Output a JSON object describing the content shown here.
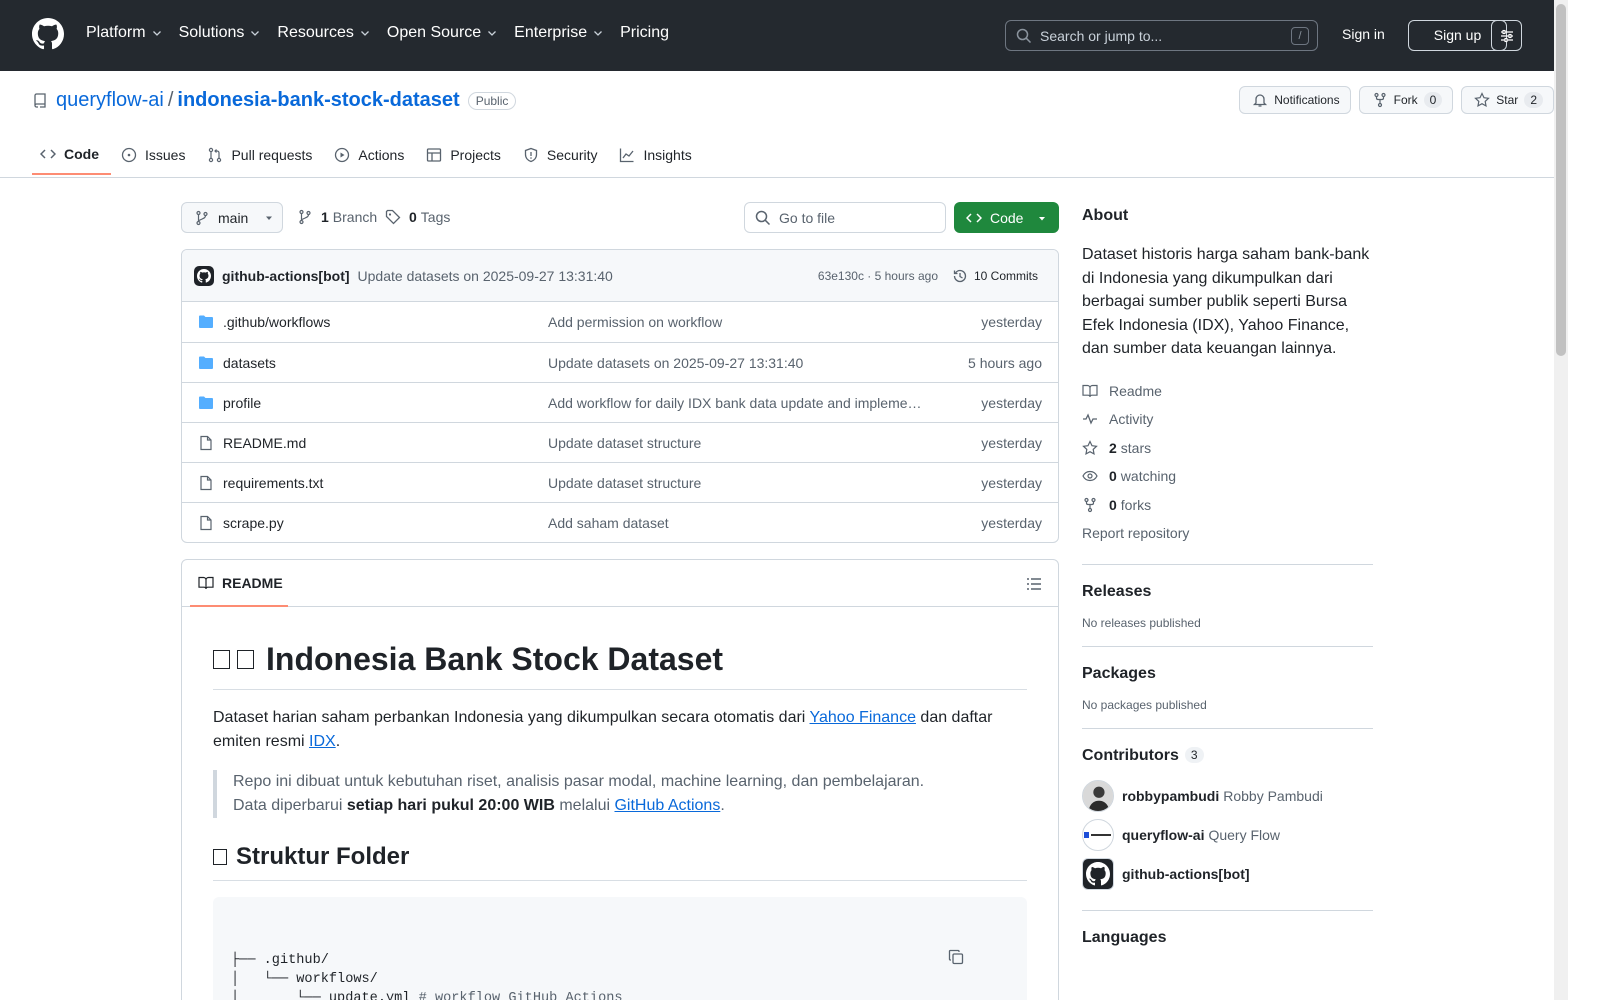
{
  "header": {
    "nav": [
      {
        "label": "Platform",
        "has_caret": true
      },
      {
        "label": "Solutions",
        "has_caret": true
      },
      {
        "label": "Resources",
        "has_caret": true
      },
      {
        "label": "Open Source",
        "has_caret": true
      },
      {
        "label": "Enterprise",
        "has_caret": true
      },
      {
        "label": "Pricing",
        "has_caret": false
      }
    ],
    "search_placeholder": "Search or jump to...",
    "search_shortcut": "/",
    "sign_in": "Sign in",
    "sign_up": "Sign up"
  },
  "repo": {
    "owner": "queryflow-ai",
    "separator": "/",
    "name": "indonesia-bank-stock-dataset",
    "visibility": "Public",
    "notifications_label": "Notifications",
    "fork_label": "Fork",
    "fork_count": "0",
    "star_label": "Star",
    "star_count": "2"
  },
  "tabs": [
    {
      "label": "Code",
      "icon": "code-icon",
      "active": true
    },
    {
      "label": "Issues",
      "icon": "issue-icon",
      "active": false
    },
    {
      "label": "Pull requests",
      "icon": "pull-request-icon",
      "active": false
    },
    {
      "label": "Actions",
      "icon": "play-icon",
      "active": false
    },
    {
      "label": "Projects",
      "icon": "table-icon",
      "active": false
    },
    {
      "label": "Security",
      "icon": "shield-icon",
      "active": false
    },
    {
      "label": "Insights",
      "icon": "graph-icon",
      "active": false
    }
  ],
  "toolbar": {
    "branch": "main",
    "branch_count": "1",
    "branch_label": "Branch",
    "tag_count": "0",
    "tag_label": "Tags",
    "goto_placeholder": "Go to file",
    "code_label": "Code"
  },
  "commit": {
    "author": "github-actions[bot]",
    "message": "Update datasets on 2025-09-27 13:31:40",
    "sha_time": "63e130c · 5 hours ago",
    "commits_label": "10 Commits"
  },
  "files": [
    {
      "name": ".github/workflows",
      "type": "dir",
      "message": "Add permission on workflow",
      "date": "yesterday"
    },
    {
      "name": "datasets",
      "type": "dir",
      "message": "Update datasets on 2025-09-27 13:31:40",
      "date": "5 hours ago"
    },
    {
      "name": "profile",
      "type": "dir",
      "message": "Add workflow for daily IDX bank data update and implement scraping script",
      "date": "yesterday"
    },
    {
      "name": "README.md",
      "type": "file",
      "message": "Update dataset structure",
      "date": "yesterday"
    },
    {
      "name": "requirements.txt",
      "type": "file",
      "message": "Update dataset structure",
      "date": "yesterday"
    },
    {
      "name": "scrape.py",
      "type": "file",
      "message": "Add saham dataset",
      "date": "yesterday"
    }
  ],
  "readme": {
    "tab_label": "README",
    "title": "Indonesia Bank Stock Dataset",
    "intro_pre": "Dataset harian saham perbankan Indonesia yang dikumpulkan secara otomatis dari ",
    "intro_link1": "Yahoo Finance",
    "intro_mid": " dan daftar emiten resmi ",
    "intro_link2": "IDX",
    "intro_post": ".",
    "quote_line1": "Repo ini dibuat untuk kebutuhan riset, analisis pasar modal, machine learning, dan pembelajaran.",
    "quote_pre": "Data diperbarui ",
    "quote_bold": "setiap hari pukul 20:00 WIB",
    "quote_mid": " melalui ",
    "quote_link": "GitHub Actions",
    "quote_post": ".",
    "section_title": "Struktur Folder",
    "code_lines": [
      {
        "text": "├── .github/",
        "comment": ""
      },
      {
        "text": "│   └── workflows/",
        "comment": ""
      },
      {
        "text": "│       └── update.yml ",
        "comment": "# workflow GitHub Actions"
      },
      {
        "text": "│",
        "comment": ""
      }
    ]
  },
  "about": {
    "title": "About",
    "description": "Dataset historis harga saham bank-bank di Indonesia yang dikumpulkan dari berbagai sumber publik seperti Bursa Efek Indonesia (IDX), Yahoo Finance, dan sumber data keuangan lainnya.",
    "readme": "Readme",
    "activity": "Activity",
    "stars_count": "2",
    "stars_label": "stars",
    "watching_count": "0",
    "watching_label": "watching",
    "forks_count": "0",
    "forks_label": "forks",
    "report": "Report repository"
  },
  "releases": {
    "title": "Releases",
    "text": "No releases published"
  },
  "packages": {
    "title": "Packages",
    "text": "No packages published"
  },
  "contributors": {
    "title": "Contributors",
    "count": "3",
    "list": [
      {
        "login": "robbypambudi",
        "name": "Robby Pambudi"
      },
      {
        "login": "queryflow-ai",
        "name": "Query Flow"
      },
      {
        "login": "github-actions[bot]",
        "name": ""
      }
    ]
  },
  "languages": {
    "title": "Languages"
  },
  "colors": {
    "header_bg": "#24292f",
    "accent": "#0969da",
    "green": "#1f883d",
    "tab_underline": "#fd8c73",
    "folder": "#54aeff"
  }
}
